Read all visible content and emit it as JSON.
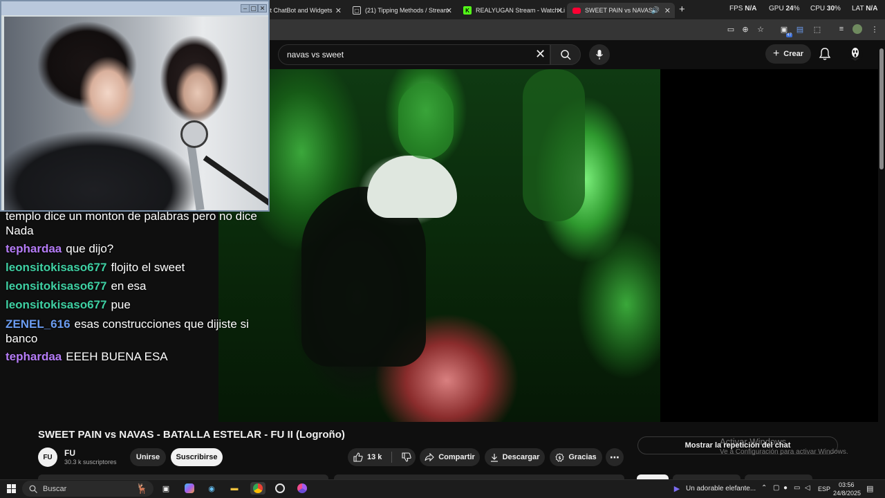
{
  "browser": {
    "tabs": [
      {
        "label": "st ChatBot and Widgets",
        "favicon": "stream-icon",
        "active": false
      },
      {
        "label": "(21) Tipping Methods / Stream",
        "favicon": "doc-icon",
        "active": false
      },
      {
        "label": "REALYUGAN Stream - Watch Li",
        "favicon": "kick-icon",
        "active": false
      },
      {
        "label": "SWEET PAIN vs NAVAS - BA",
        "favicon": "youtube-icon",
        "active": true
      }
    ],
    "perf": {
      "fps_label": "FPS",
      "fps_value": "N/A",
      "gpu_label": "GPU",
      "gpu_value": "24",
      "cpu_label": "CPU",
      "cpu_value": "30",
      "lat_label": "LAT",
      "lat_value": "N/A",
      "percent": "%"
    },
    "extension_badge": "47"
  },
  "youtube": {
    "search_value": "navas vs sweet",
    "create_label": "Crear",
    "video": {
      "title": "SWEET PAIN vs NAVAS - BATALLA ESTELAR - FU II (Logroño)",
      "channel": "FU",
      "subscribers": "30.3 k suscriptores",
      "join_label": "Unirse",
      "subscribe_label": "Suscribirse",
      "likes": "13 k",
      "share_label": "Compartir",
      "download_label": "Descargar",
      "thanks_label": "Gracias",
      "chat_replay_label": "Mostrar la repetición del chat"
    }
  },
  "stream_chat": [
    {
      "user": "",
      "text": "templo dice un monton de palabras pero no dice",
      "color": "#ffffff"
    },
    {
      "user": "",
      "text": "Nada",
      "color": "#ffffff"
    },
    {
      "user": "tephardaa",
      "text": "que dijo?",
      "color": "#b57cf7"
    },
    {
      "user": "leonsitokisaso677",
      "text": "flojito el sweet",
      "color": "#3fd0a3"
    },
    {
      "user": "leonsitokisaso677",
      "text": "en esa",
      "color": "#3fd0a3"
    },
    {
      "user": "leonsitokisaso677",
      "text": "pue",
      "color": "#3fd0a3"
    },
    {
      "user": "ZENEL_616",
      "text": "esas construcciones que dijiste si",
      "color": "#6b9cf0"
    },
    {
      "user": "",
      "text": "banco",
      "color": "#ffffff"
    },
    {
      "user": "tephardaa",
      "text": "EEEH BUENA ESA",
      "color": "#b57cf7"
    }
  ],
  "windows_watermark": {
    "line1": "Activar Windows",
    "line2": "Ve a Configuración para activar Windows."
  },
  "taskbar": {
    "search_placeholder": "Buscar",
    "now_playing": "Un adorable elefante...",
    "language": "ESP",
    "time": "03:56",
    "date": "24/8/2025"
  }
}
